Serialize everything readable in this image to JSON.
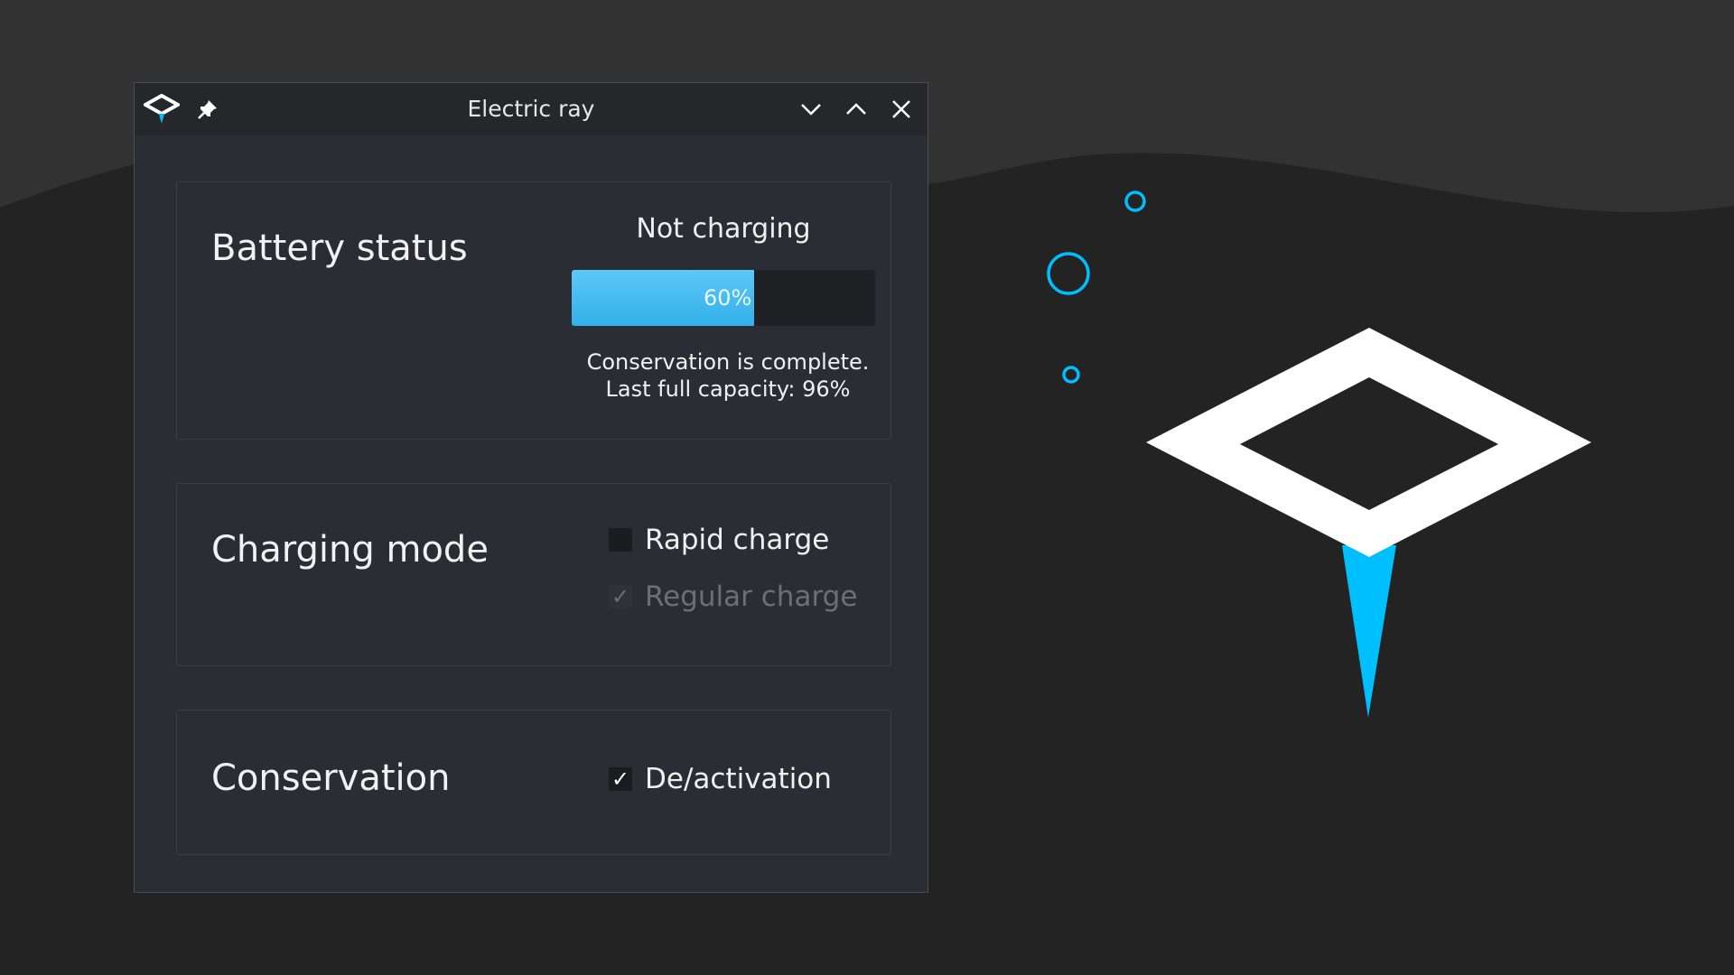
{
  "window": {
    "title": "Electric ray",
    "controls": [
      "minimize",
      "maximize",
      "close"
    ]
  },
  "battery": {
    "section_title": "Battery status",
    "status": "Not charging",
    "progress_percent": 60,
    "progress_label": "60%",
    "info_line1": "Conservation is complete.",
    "info_line2": "Last full capacity: 96%"
  },
  "charging_mode": {
    "section_title": "Charging mode",
    "options": [
      {
        "label": "Rapid charge",
        "checked": false,
        "disabled": false
      },
      {
        "label": "Regular charge",
        "checked": true,
        "disabled": true
      }
    ]
  },
  "conservation": {
    "section_title": "Conservation",
    "option": {
      "label": "De/activation",
      "checked": true
    }
  },
  "colors": {
    "accent": "#00bfff",
    "window_bg": "#2a2d33",
    "titlebar_bg": "#25272b",
    "desktop_bg": "#232323",
    "desktop_wave": "#323232"
  }
}
